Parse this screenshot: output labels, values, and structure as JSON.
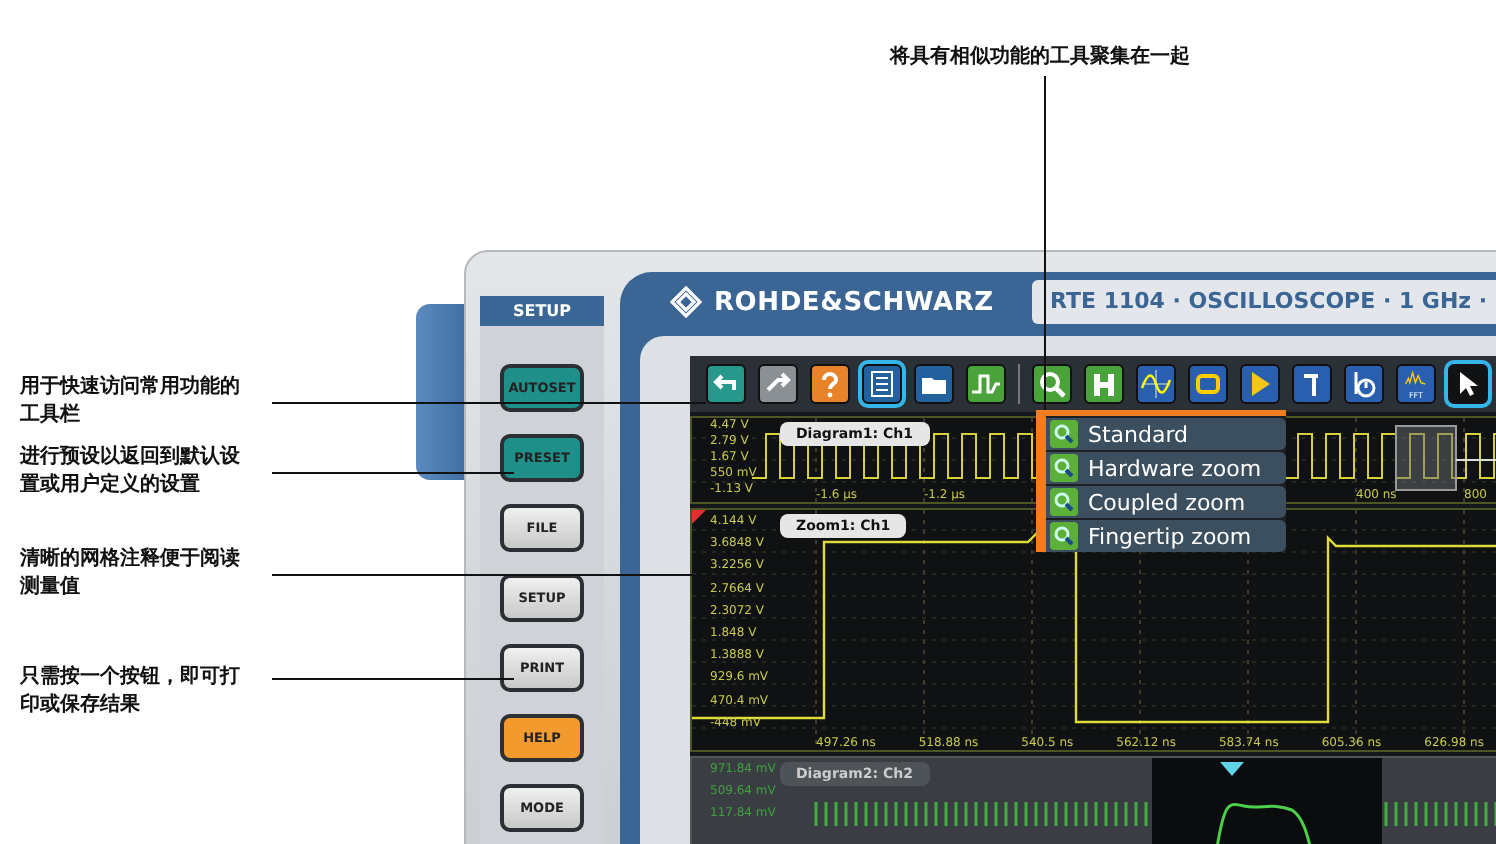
{
  "caption": "将具有相似功能的工具聚集在一起",
  "callouts": [
    {
      "text": "用于快速访问常用功能的工具栏"
    },
    {
      "text": "进行预设以返回到默认设置或用户定义的设置"
    },
    {
      "text": "清晰的网格注释便于阅读测量值"
    },
    {
      "text": "只需按一个按钮，即可打印或保存结果"
    }
  ],
  "instrument": {
    "brand": "ROHDE&SCHWARZ",
    "model": "RTE 1104 · OSCILLOSCOPE · 1 GHz ·",
    "side_panel": {
      "title": "SETUP",
      "buttons": [
        {
          "label": "AUTOSET",
          "kind": "accent"
        },
        {
          "label": "PRESET",
          "kind": "accent"
        },
        {
          "label": "FILE",
          "kind": "plain"
        },
        {
          "label": "SETUP",
          "kind": "plain"
        },
        {
          "label": "PRINT",
          "kind": "plain"
        },
        {
          "label": "HELP",
          "kind": "warning"
        },
        {
          "label": "MODE",
          "kind": "plain"
        }
      ]
    },
    "toolbar": {
      "tools": [
        {
          "kind": "undo",
          "highlighted": false
        },
        {
          "kind": "redo",
          "highlighted": false
        },
        {
          "kind": "help",
          "highlighted": false
        },
        {
          "kind": "layout",
          "highlighted": true
        },
        {
          "kind": "folder",
          "highlighted": false
        },
        {
          "kind": "signal",
          "highlighted": false
        },
        {
          "kind": "separator"
        },
        {
          "kind": "zoom",
          "highlighted": false
        },
        {
          "kind": "histogram",
          "highlighted": false
        },
        {
          "kind": "math",
          "highlighted": false
        },
        {
          "kind": "display",
          "highlighted": false
        },
        {
          "kind": "marker",
          "highlighted": false
        },
        {
          "kind": "cursor",
          "highlighted": false
        },
        {
          "kind": "timer",
          "highlighted": false
        },
        {
          "kind": "fft",
          "label": "FFT",
          "highlighted": false
        },
        {
          "kind": "pointer",
          "highlighted": true
        }
      ]
    },
    "zoom_menu": {
      "items": [
        {
          "label": "Standard"
        },
        {
          "label": "Hardware zoom"
        },
        {
          "label": "Coupled zoom"
        },
        {
          "label": "Fingertip zoom"
        }
      ]
    },
    "diagrams": [
      {
        "kind": "overview",
        "tab": "Diagram1: Ch1",
        "y_labels": [
          "4.47 V",
          "2.79 V",
          "1.67 V",
          "550 mV",
          "-1.13 V"
        ],
        "x_labels": [
          "-1.6 µs",
          "-1.2 µs",
          "400 ns",
          "800"
        ]
      },
      {
        "kind": "zoom",
        "tab": "Zoom1: Ch1",
        "y_labels": [
          "4.144 V",
          "3.6848 V",
          "3.2256 V",
          "2.7664 V",
          "2.3072 V",
          "1.848 V",
          "1.3888 V",
          "929.6 mV",
          "470.4 mV",
          "-448 mV"
        ],
        "x_labels": [
          "497.26 ns",
          "518.88 ns",
          "540.5 ns",
          "562.12 ns",
          "583.74 ns",
          "605.36 ns",
          "626.98 ns"
        ]
      },
      {
        "kind": "pulses",
        "tab": "Diagram2: Ch2",
        "y_labels": [
          "971.84 mV",
          "509.64 mV",
          "117.84 mV"
        ]
      }
    ]
  }
}
